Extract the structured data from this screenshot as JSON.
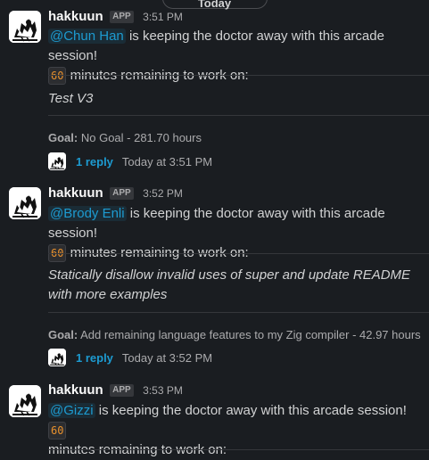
{
  "date_divider": "Today",
  "messages": [
    {
      "user": "hakkuun",
      "badge": "APP",
      "time": "3:51 PM",
      "mention": "@Chun Han",
      "text_a": " is keeping the doctor away with this arcade session!",
      "minutes": "60",
      "text_b": " minutes remaining to work on:",
      "task": "Test V3",
      "goal_label": "Goal:",
      "goal_text": " No Goal - 281.70 hours",
      "reply_label": "1 reply",
      "reply_time": "Today at 3:51 PM"
    },
    {
      "user": "hakkuun",
      "badge": "APP",
      "time": "3:52 PM",
      "mention": "@Brody Enli",
      "text_a": " is keeping the doctor away with this arcade session!",
      "minutes": "60",
      "text_b": " minutes remaining to work on:",
      "task": "Statically disallow invalid uses of super and update README with more examples",
      "goal_label": "Goal:",
      "goal_text": " Add remaining language features to my Zig compiler - 42.97 hours",
      "reply_label": "1 reply",
      "reply_time": "Today at 3:52 PM"
    },
    {
      "user": "hakkuun",
      "badge": "APP",
      "time": "3:53 PM",
      "mention": "@Gizzi",
      "text_a": " is keeping the doctor away with this arcade session! ",
      "minutes": "60",
      "text_b": " minutes remaining to work on:"
    }
  ]
}
